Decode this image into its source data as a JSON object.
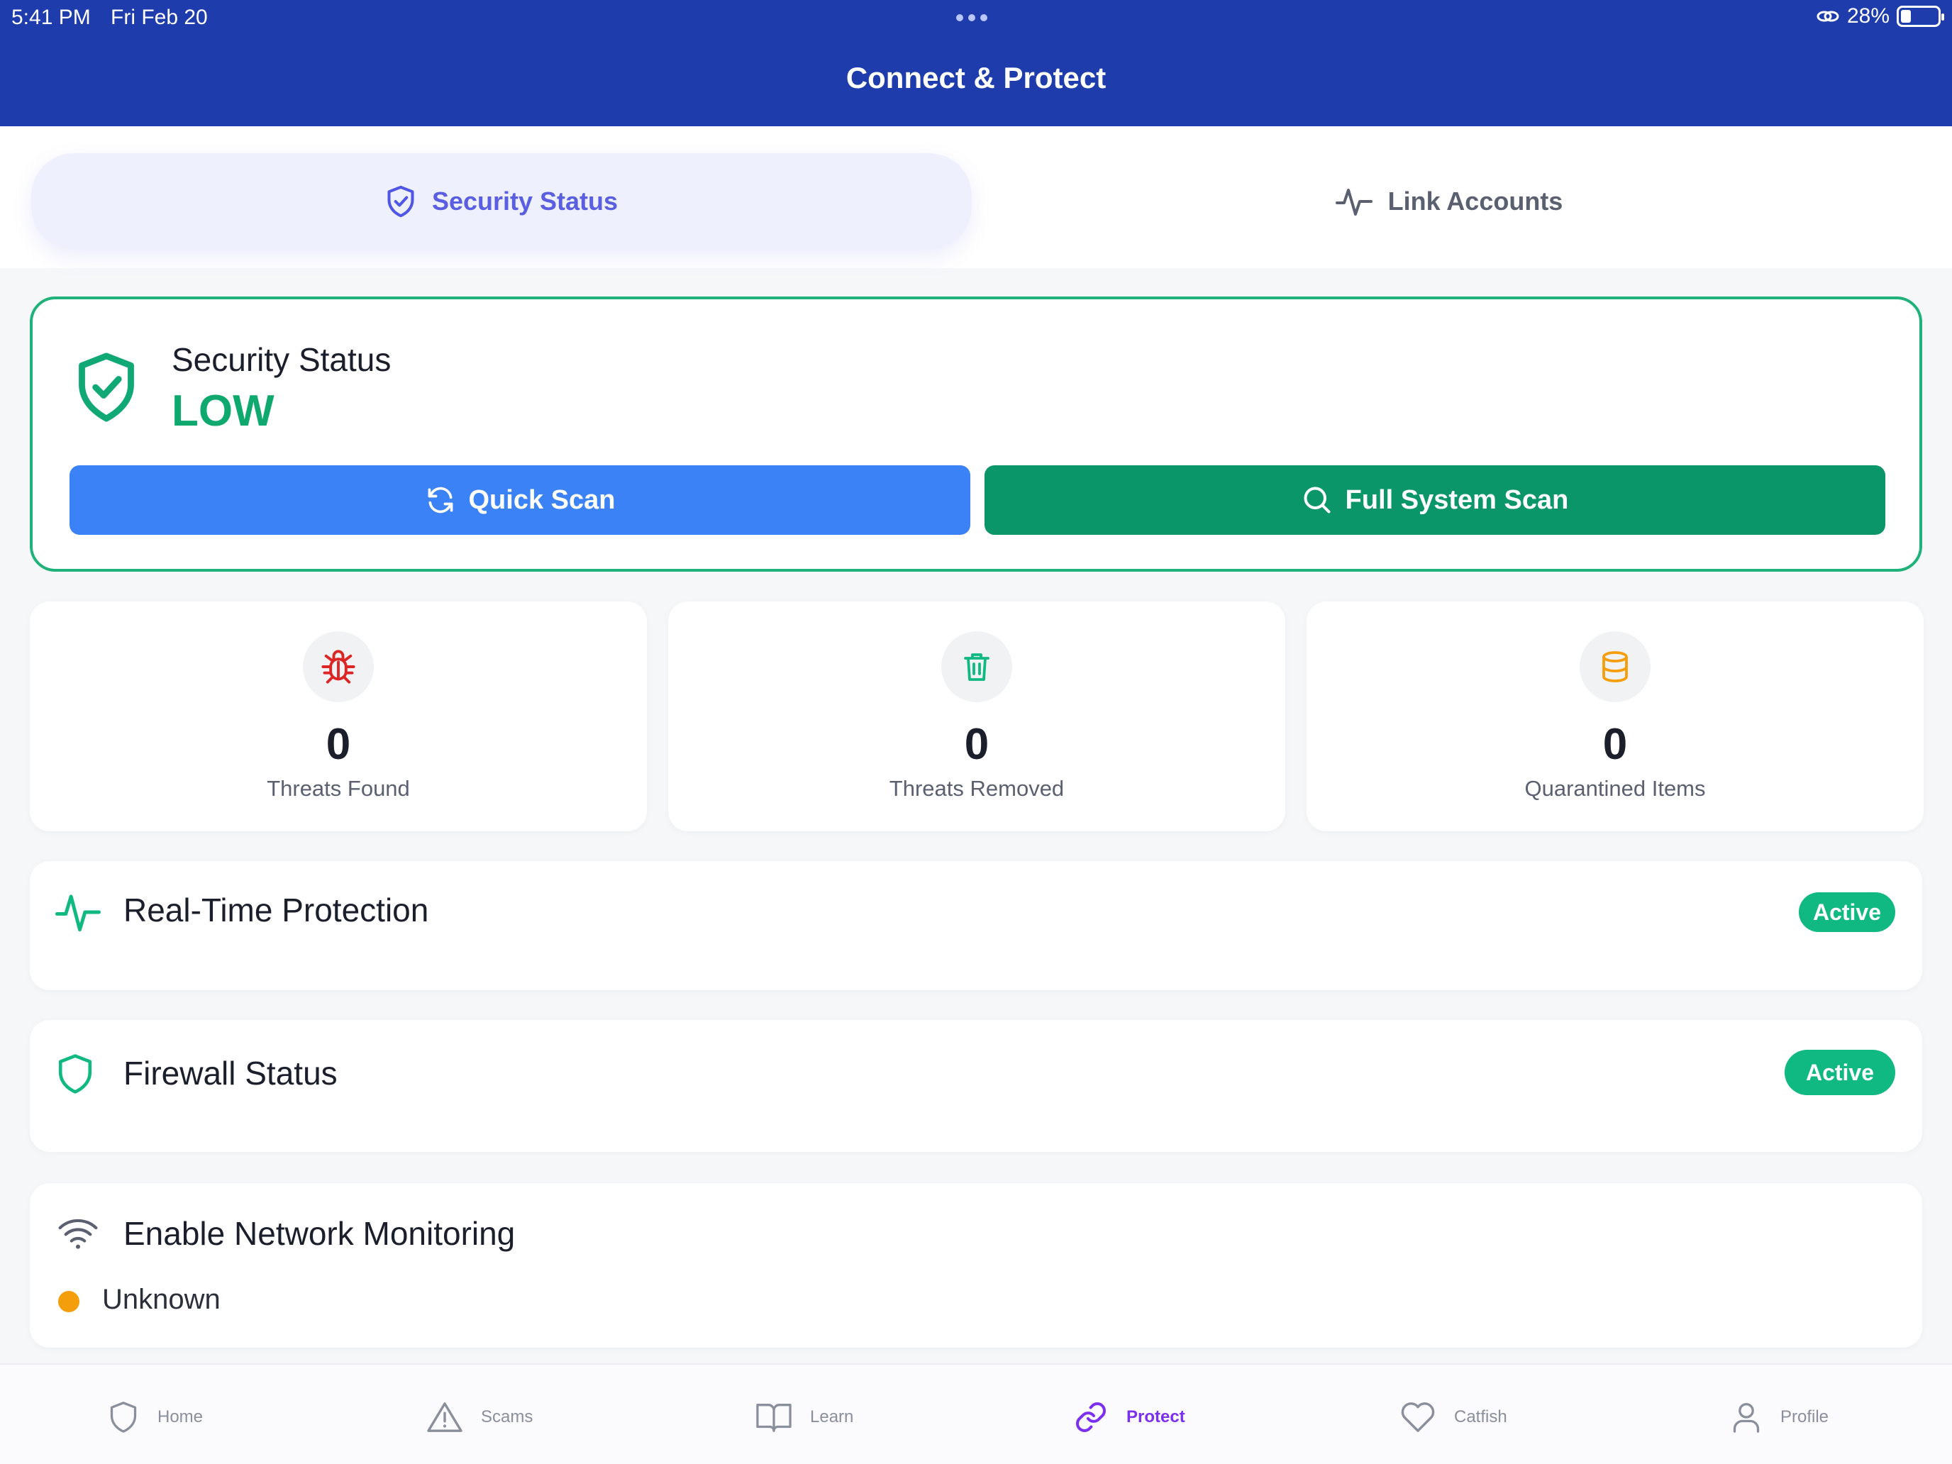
{
  "status_bar": {
    "time": "5:41 PM",
    "date": "Fri Feb 20",
    "battery": "28%"
  },
  "app": {
    "title": "Connect & Protect"
  },
  "tabs": [
    {
      "label": "Security Status",
      "icon": "shield-check-icon",
      "active": true
    },
    {
      "label": "Link Accounts",
      "icon": "activity-icon",
      "active": false
    }
  ],
  "status_card": {
    "label": "Security Status",
    "level": "LOW",
    "quick_scan": "Quick Scan",
    "full_scan": "Full System Scan"
  },
  "stats": [
    {
      "value": "0",
      "label": "Threats Found",
      "icon": "bug-icon",
      "color": "#dc2626"
    },
    {
      "value": "0",
      "label": "Threats Removed",
      "icon": "trash-icon",
      "color": "#10b981"
    },
    {
      "value": "0",
      "label": "Quarantined Items",
      "icon": "database-icon",
      "color": "#f59e0b"
    }
  ],
  "features": {
    "realtime": {
      "title": "Real-Time Protection",
      "status": "Active"
    },
    "firewall": {
      "title": "Firewall Status",
      "status": "Active"
    },
    "network": {
      "title": "Enable Network Monitoring",
      "status": "Unknown"
    }
  },
  "nav": [
    {
      "label": "Home",
      "icon": "shield-icon"
    },
    {
      "label": "Scams",
      "icon": "warning-icon"
    },
    {
      "label": "Learn",
      "icon": "book-icon"
    },
    {
      "label": "Protect",
      "icon": "link-icon",
      "active": true
    },
    {
      "label": "Catfish",
      "icon": "heart-icon"
    },
    {
      "label": "Profile",
      "icon": "user-icon"
    }
  ],
  "colors": {
    "header": "#1f3cac",
    "accent": "#5a5ee0",
    "success": "#0fa86f",
    "quick_scan": "#3b82f6",
    "full_scan": "#0a9668",
    "nav_active": "#7b2ff0"
  }
}
